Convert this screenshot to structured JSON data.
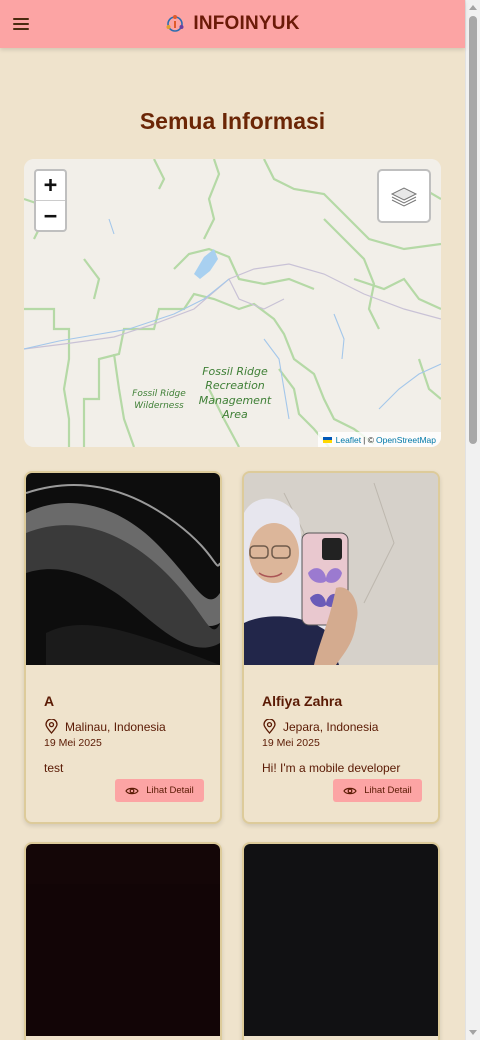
{
  "header": {
    "brand": "INFOINYUK",
    "menu_icon": "hamburger-icon"
  },
  "page": {
    "title": "Semua Informasi"
  },
  "map": {
    "zoom_in": "+",
    "zoom_out": "−",
    "labels": {
      "area_line1": "Fossil Ridge",
      "area_line2": "Recreation",
      "area_line3": "Management",
      "area_line4": "Area",
      "wild_line1": "Fossil Ridge",
      "wild_line2": "Wilderness"
    },
    "attribution": {
      "leaflet": "Leaflet",
      "separator": "| ©",
      "osm": "OpenStreetMap"
    }
  },
  "cards": [
    {
      "name": "A",
      "location": "Malinau, Indonesia",
      "date": "19 Mei 2025",
      "description": "test",
      "button": "Lihat Detail"
    },
    {
      "name": "Alfiya Zahra",
      "location": "Jepara, Indonesia",
      "date": "19 Mei 2025",
      "description": "Hi! I'm a mobile developer",
      "button": "Lihat Detail"
    }
  ],
  "colors": {
    "header": "#fca4a4",
    "background": "#efe3cc",
    "title": "#6b2606",
    "card_border": "#ddcb9a"
  }
}
